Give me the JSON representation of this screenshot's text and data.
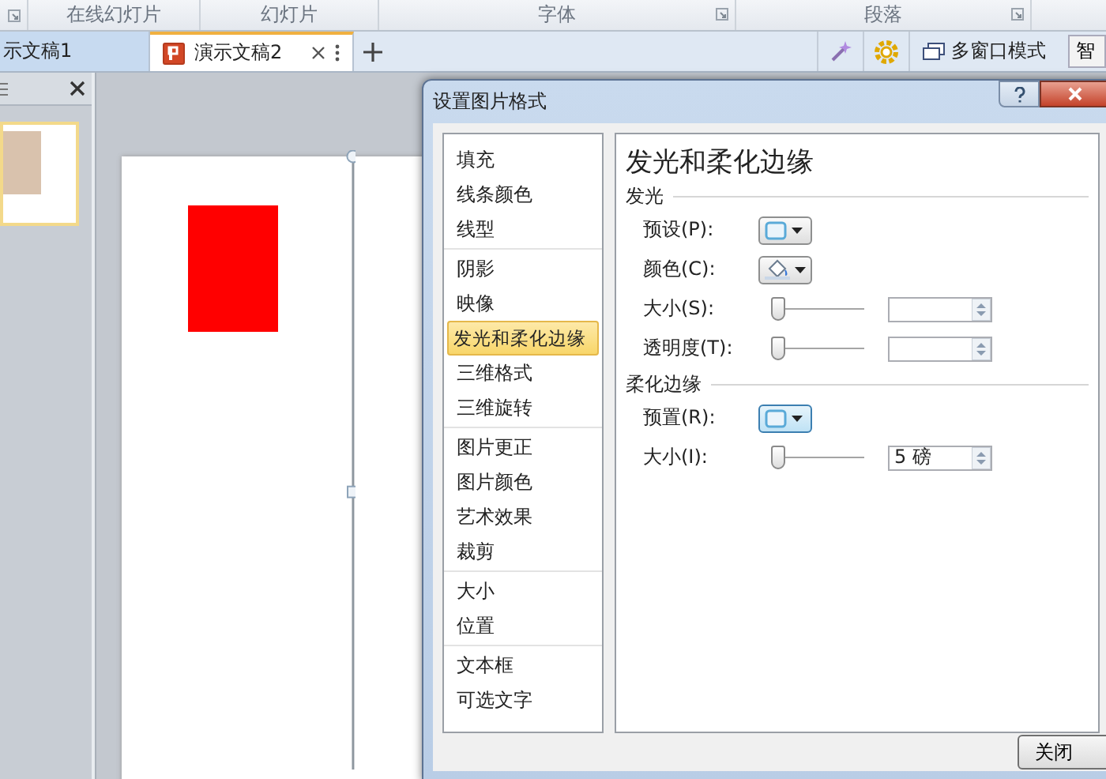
{
  "ribbon": {
    "groups": [
      {
        "label": "在线幻灯片",
        "launcher": false
      },
      {
        "label": "幻灯片",
        "launcher": false
      },
      {
        "label": "字体",
        "launcher": true
      },
      {
        "label": "段落",
        "launcher": true
      }
    ]
  },
  "doc_tabs": [
    {
      "label": "示文稿1",
      "selected": false
    },
    {
      "label": "演示文稿2",
      "selected": true
    }
  ],
  "toolbar": {
    "multi_window": "多窗口模式",
    "smart": "智"
  },
  "dialog": {
    "title": "设置图片格式",
    "category_groups": [
      [
        {
          "label": "填充",
          "selected": false
        },
        {
          "label": "线条颜色",
          "selected": false
        },
        {
          "label": "线型",
          "selected": false
        }
      ],
      [
        {
          "label": "阴影",
          "selected": false
        },
        {
          "label": "映像",
          "selected": false
        },
        {
          "label": "发光和柔化边缘",
          "selected": true
        },
        {
          "label": "三维格式",
          "selected": false
        },
        {
          "label": "三维旋转",
          "selected": false
        }
      ],
      [
        {
          "label": "图片更正",
          "selected": false
        },
        {
          "label": "图片颜色",
          "selected": false
        },
        {
          "label": "艺术效果",
          "selected": false
        },
        {
          "label": "裁剪",
          "selected": false
        }
      ],
      [
        {
          "label": "大小",
          "selected": false
        },
        {
          "label": "位置",
          "selected": false
        }
      ],
      [
        {
          "label": "文本框",
          "selected": false
        },
        {
          "label": "可选文字",
          "selected": false
        }
      ]
    ],
    "heading": "发光和柔化边缘",
    "sections": [
      {
        "title": "发光",
        "rows": [
          {
            "kind": "preset",
            "label": "预设(P):"
          },
          {
            "kind": "color",
            "label": "颜色(C):"
          },
          {
            "kind": "slider",
            "label": "大小(S):",
            "level": 0
          },
          {
            "kind": "slider",
            "label": "透明度(T):",
            "level": 0
          }
        ]
      },
      {
        "title": "柔化边缘",
        "rows": [
          {
            "kind": "preset",
            "label": "预置(R):"
          },
          {
            "kind": "slider",
            "label": "大小(I):",
            "level": 0,
            "value": "5 磅"
          }
        ]
      }
    ],
    "close_button": "关闭"
  }
}
